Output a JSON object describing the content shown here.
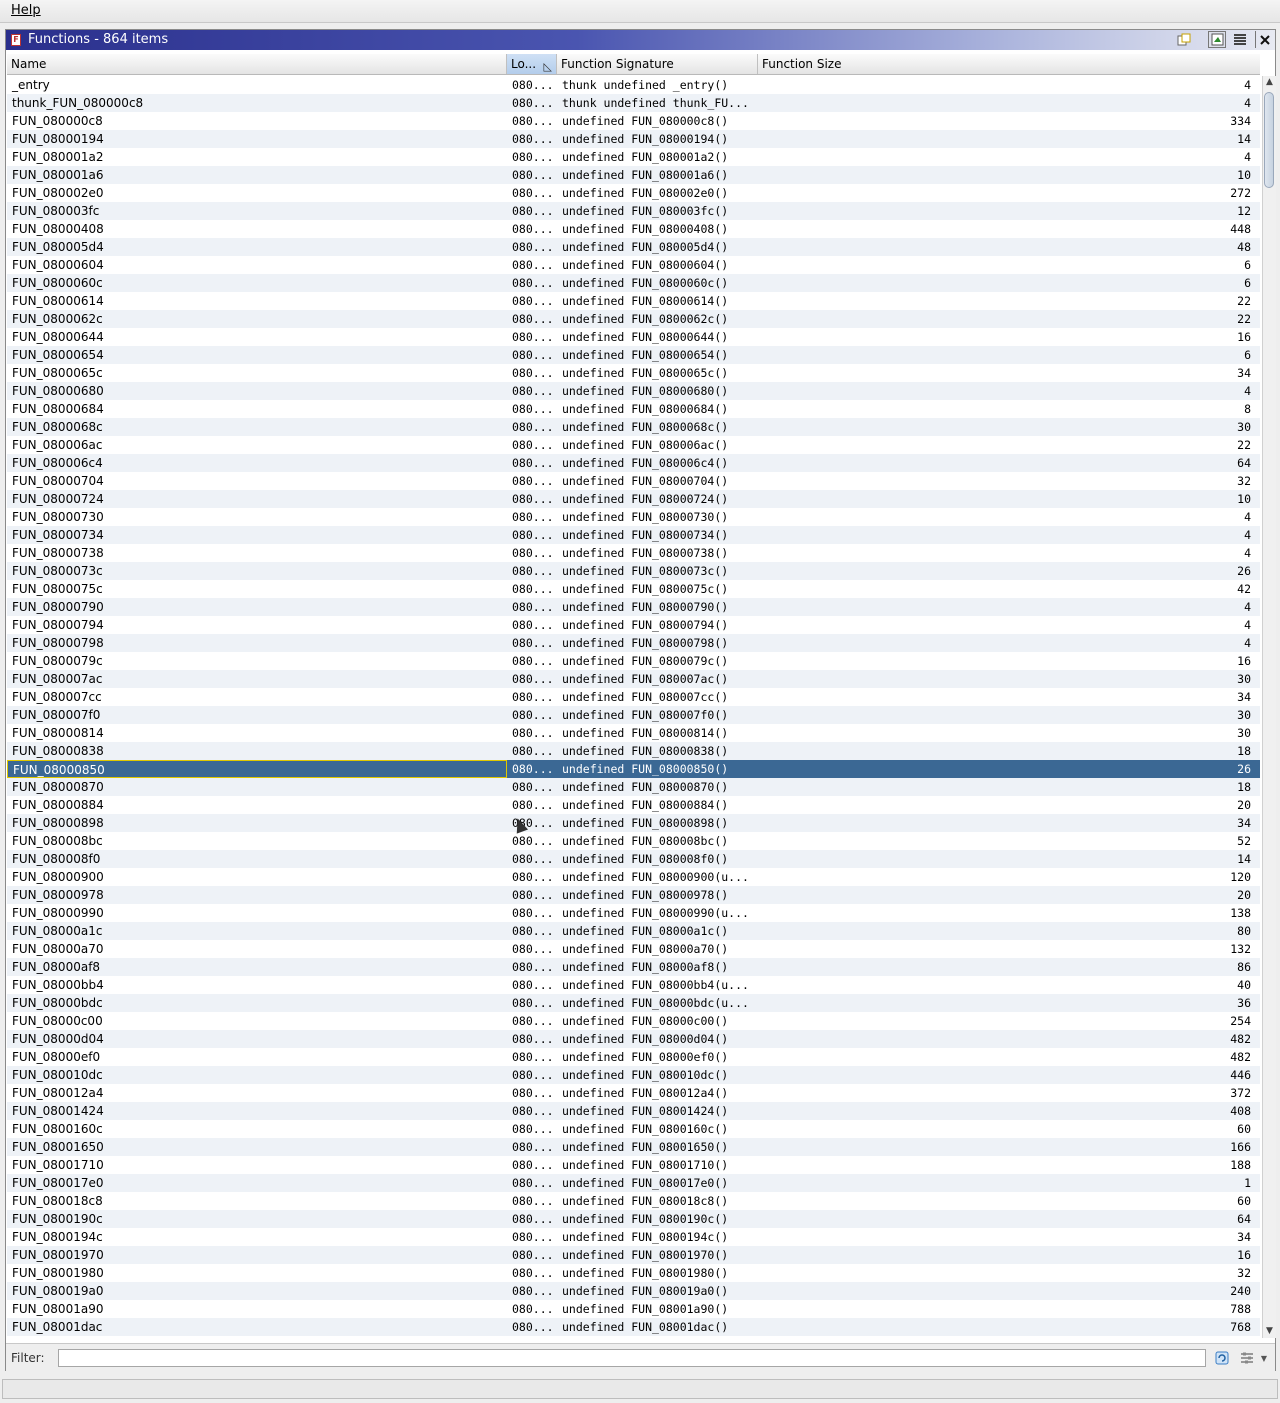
{
  "menu": {
    "help_label": "Help"
  },
  "window": {
    "title": "Functions - 864 items",
    "title_icon": "F"
  },
  "columns": [
    {
      "label": "Name"
    },
    {
      "label": "Lo..."
    },
    {
      "label": "Function Signature"
    },
    {
      "label": "Function Size"
    }
  ],
  "rows": [
    [
      "_entry",
      "080...",
      "thunk undefined _entry()",
      "4"
    ],
    [
      "thunk_FUN_080000c8",
      "080...",
      "thunk undefined thunk_FU...",
      "4"
    ],
    [
      "FUN_080000c8",
      "080...",
      "undefined FUN_080000c8()",
      "334"
    ],
    [
      "FUN_08000194",
      "080...",
      "undefined FUN_08000194()",
      "14"
    ],
    [
      "FUN_080001a2",
      "080...",
      "undefined FUN_080001a2()",
      "4"
    ],
    [
      "FUN_080001a6",
      "080...",
      "undefined FUN_080001a6()",
      "10"
    ],
    [
      "FUN_080002e0",
      "080...",
      "undefined FUN_080002e0()",
      "272"
    ],
    [
      "FUN_080003fc",
      "080...",
      "undefined FUN_080003fc()",
      "12"
    ],
    [
      "FUN_08000408",
      "080...",
      "undefined FUN_08000408()",
      "448"
    ],
    [
      "FUN_080005d4",
      "080...",
      "undefined FUN_080005d4()",
      "48"
    ],
    [
      "FUN_08000604",
      "080...",
      "undefined FUN_08000604()",
      "6"
    ],
    [
      "FUN_0800060c",
      "080...",
      "undefined FUN_0800060c()",
      "6"
    ],
    [
      "FUN_08000614",
      "080...",
      "undefined FUN_08000614()",
      "22"
    ],
    [
      "FUN_0800062c",
      "080...",
      "undefined FUN_0800062c()",
      "22"
    ],
    [
      "FUN_08000644",
      "080...",
      "undefined FUN_08000644()",
      "16"
    ],
    [
      "FUN_08000654",
      "080...",
      "undefined FUN_08000654()",
      "6"
    ],
    [
      "FUN_0800065c",
      "080...",
      "undefined FUN_0800065c()",
      "34"
    ],
    [
      "FUN_08000680",
      "080...",
      "undefined FUN_08000680()",
      "4"
    ],
    [
      "FUN_08000684",
      "080...",
      "undefined FUN_08000684()",
      "8"
    ],
    [
      "FUN_0800068c",
      "080...",
      "undefined FUN_0800068c()",
      "30"
    ],
    [
      "FUN_080006ac",
      "080...",
      "undefined FUN_080006ac()",
      "22"
    ],
    [
      "FUN_080006c4",
      "080...",
      "undefined FUN_080006c4()",
      "64"
    ],
    [
      "FUN_08000704",
      "080...",
      "undefined FUN_08000704()",
      "32"
    ],
    [
      "FUN_08000724",
      "080...",
      "undefined FUN_08000724()",
      "10"
    ],
    [
      "FUN_08000730",
      "080...",
      "undefined FUN_08000730()",
      "4"
    ],
    [
      "FUN_08000734",
      "080...",
      "undefined FUN_08000734()",
      "4"
    ],
    [
      "FUN_08000738",
      "080...",
      "undefined FUN_08000738()",
      "4"
    ],
    [
      "FUN_0800073c",
      "080...",
      "undefined FUN_0800073c()",
      "26"
    ],
    [
      "FUN_0800075c",
      "080...",
      "undefined FUN_0800075c()",
      "42"
    ],
    [
      "FUN_08000790",
      "080...",
      "undefined FUN_08000790()",
      "4"
    ],
    [
      "FUN_08000794",
      "080...",
      "undefined FUN_08000794()",
      "4"
    ],
    [
      "FUN_08000798",
      "080...",
      "undefined FUN_08000798()",
      "4"
    ],
    [
      "FUN_0800079c",
      "080...",
      "undefined FUN_0800079c()",
      "16"
    ],
    [
      "FUN_080007ac",
      "080...",
      "undefined FUN_080007ac()",
      "30"
    ],
    [
      "FUN_080007cc",
      "080...",
      "undefined FUN_080007cc()",
      "34"
    ],
    [
      "FUN_080007f0",
      "080...",
      "undefined FUN_080007f0()",
      "30"
    ],
    [
      "FUN_08000814",
      "080...",
      "undefined FUN_08000814()",
      "30"
    ],
    [
      "FUN_08000838",
      "080...",
      "undefined FUN_08000838()",
      "18"
    ],
    [
      "FUN_08000850",
      "080...",
      "undefined FUN_08000850()",
      "26"
    ],
    [
      "FUN_08000870",
      "080...",
      "undefined FUN_08000870()",
      "18"
    ],
    [
      "FUN_08000884",
      "080...",
      "undefined FUN_08000884()",
      "20"
    ],
    [
      "FUN_08000898",
      "080...",
      "undefined FUN_08000898()",
      "34"
    ],
    [
      "FUN_080008bc",
      "080...",
      "undefined FUN_080008bc()",
      "52"
    ],
    [
      "FUN_080008f0",
      "080...",
      "undefined FUN_080008f0()",
      "14"
    ],
    [
      "FUN_08000900",
      "080...",
      "undefined FUN_08000900(u...",
      "120"
    ],
    [
      "FUN_08000978",
      "080...",
      "undefined FUN_08000978()",
      "20"
    ],
    [
      "FUN_08000990",
      "080...",
      "undefined FUN_08000990(u...",
      "138"
    ],
    [
      "FUN_08000a1c",
      "080...",
      "undefined FUN_08000a1c()",
      "80"
    ],
    [
      "FUN_08000a70",
      "080...",
      "undefined FUN_08000a70()",
      "132"
    ],
    [
      "FUN_08000af8",
      "080...",
      "undefined FUN_08000af8()",
      "86"
    ],
    [
      "FUN_08000bb4",
      "080...",
      "undefined FUN_08000bb4(u...",
      "40"
    ],
    [
      "FUN_08000bdc",
      "080...",
      "undefined FUN_08000bdc(u...",
      "36"
    ],
    [
      "FUN_08000c00",
      "080...",
      "undefined FUN_08000c00()",
      "254"
    ],
    [
      "FUN_08000d04",
      "080...",
      "undefined FUN_08000d04()",
      "482"
    ],
    [
      "FUN_08000ef0",
      "080...",
      "undefined FUN_08000ef0()",
      "482"
    ],
    [
      "FUN_080010dc",
      "080...",
      "undefined FUN_080010dc()",
      "446"
    ],
    [
      "FUN_080012a4",
      "080...",
      "undefined FUN_080012a4()",
      "372"
    ],
    [
      "FUN_08001424",
      "080...",
      "undefined FUN_08001424()",
      "408"
    ],
    [
      "FUN_0800160c",
      "080...",
      "undefined FUN_0800160c()",
      "60"
    ],
    [
      "FUN_08001650",
      "080...",
      "undefined FUN_08001650()",
      "166"
    ],
    [
      "FUN_08001710",
      "080...",
      "undefined FUN_08001710()",
      "188"
    ],
    [
      "FUN_080017e0",
      "080...",
      "undefined FUN_080017e0()",
      "1"
    ],
    [
      "FUN_080018c8",
      "080...",
      "undefined FUN_080018c8()",
      "60"
    ],
    [
      "FUN_0800190c",
      "080...",
      "undefined FUN_0800190c()",
      "64"
    ],
    [
      "FUN_0800194c",
      "080...",
      "undefined FUN_0800194c()",
      "34"
    ],
    [
      "FUN_08001970",
      "080...",
      "undefined FUN_08001970()",
      "16"
    ],
    [
      "FUN_08001980",
      "080...",
      "undefined FUN_08001980()",
      "32"
    ],
    [
      "FUN_080019a0",
      "080...",
      "undefined FUN_080019a0()",
      "240"
    ],
    [
      "FUN_08001a90",
      "080...",
      "undefined FUN_08001a90()",
      "788"
    ],
    [
      "FUN_08001dac",
      "080...",
      "undefined FUN_08001dac()",
      "768"
    ]
  ],
  "selected_row_index": 38,
  "filter": {
    "label": "Filter:",
    "value": ""
  },
  "colors": {
    "title_gradient_start": "#2a2f8c",
    "selected_row": "#3b6894",
    "alt_row": "#eef2f7",
    "sorted_header": "#b3cdeb"
  },
  "icons": {
    "title": "functions-window-icon",
    "toolbar": [
      "copy-icon",
      "navigate-icon",
      "table-view-icon",
      "close-icon"
    ],
    "filter": [
      "filter-refresh-icon",
      "filter-options-icon",
      "dropdown-arrow-icon"
    ]
  }
}
